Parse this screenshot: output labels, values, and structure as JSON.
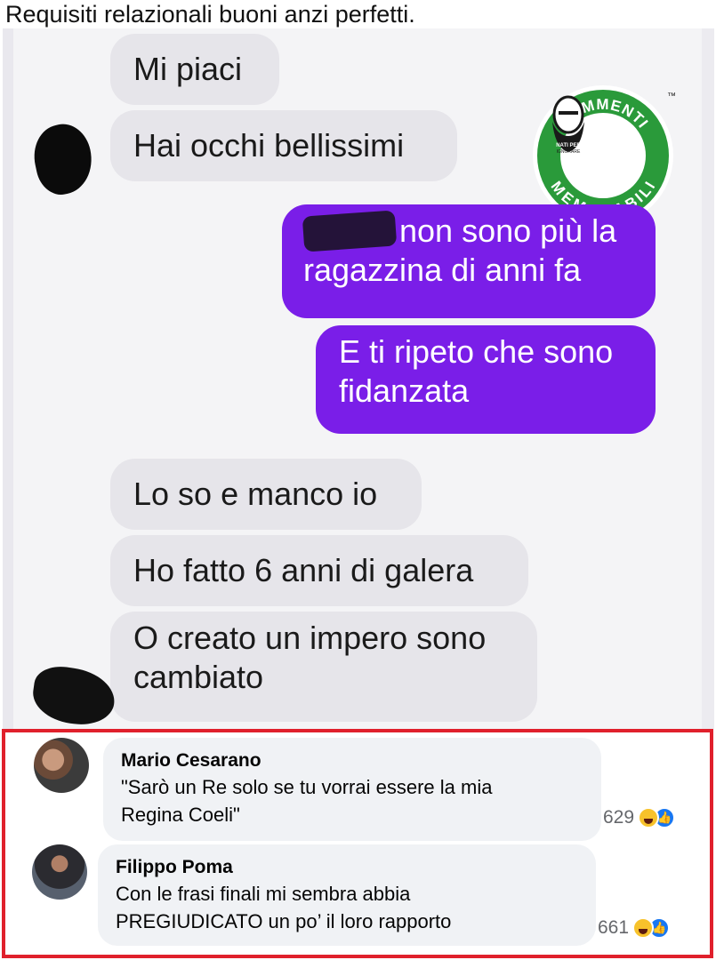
{
  "caption": "Requisiti relazionali buoni anzi perfetti.",
  "chat": {
    "messages": [
      {
        "side": "in",
        "text": "Mi piaci"
      },
      {
        "side": "in",
        "text": "Hai occhi bellissimi"
      },
      {
        "side": "out",
        "line1": "non sono più la",
        "line2": "ragazzina di anni fa"
      },
      {
        "side": "out",
        "line1": "E ti ripeto che sono",
        "line2": "fidanzata"
      },
      {
        "side": "in",
        "text": "Lo so e manco io"
      },
      {
        "side": "in",
        "text": "Ho fatto 6 anni di galera"
      },
      {
        "side": "in",
        "line1": "O creato un impero sono",
        "line2": "cambiato"
      }
    ],
    "watermark": {
      "top_text": "COMMENTI",
      "bottom_text": "MEMORABILI",
      "tagline_1": "NATI PER",
      "tagline_2": "IGNORARE",
      "trademark": "™",
      "colors": {
        "ring": "#2a9a3a"
      }
    },
    "colors": {
      "incoming": "#e6e5ea",
      "outgoing": "#7a1ee8"
    }
  },
  "comments": {
    "highlight_color": "#e0202c",
    "items": [
      {
        "author": "Mario Cesarano",
        "line1": "\"Sarò un Re solo se tu vorrai essere la mia",
        "line2": "Regina Coeli\"",
        "reaction_count": "629",
        "reactions": [
          "haha-icon",
          "like-icon"
        ]
      },
      {
        "author": "Filippo Poma",
        "line1": "Con le frasi finali mi sembra abbia",
        "line2": "PREGIUDICATO un po’ il loro rapporto",
        "reaction_count": "661",
        "reactions": [
          "haha-icon",
          "like-icon"
        ]
      }
    ]
  }
}
